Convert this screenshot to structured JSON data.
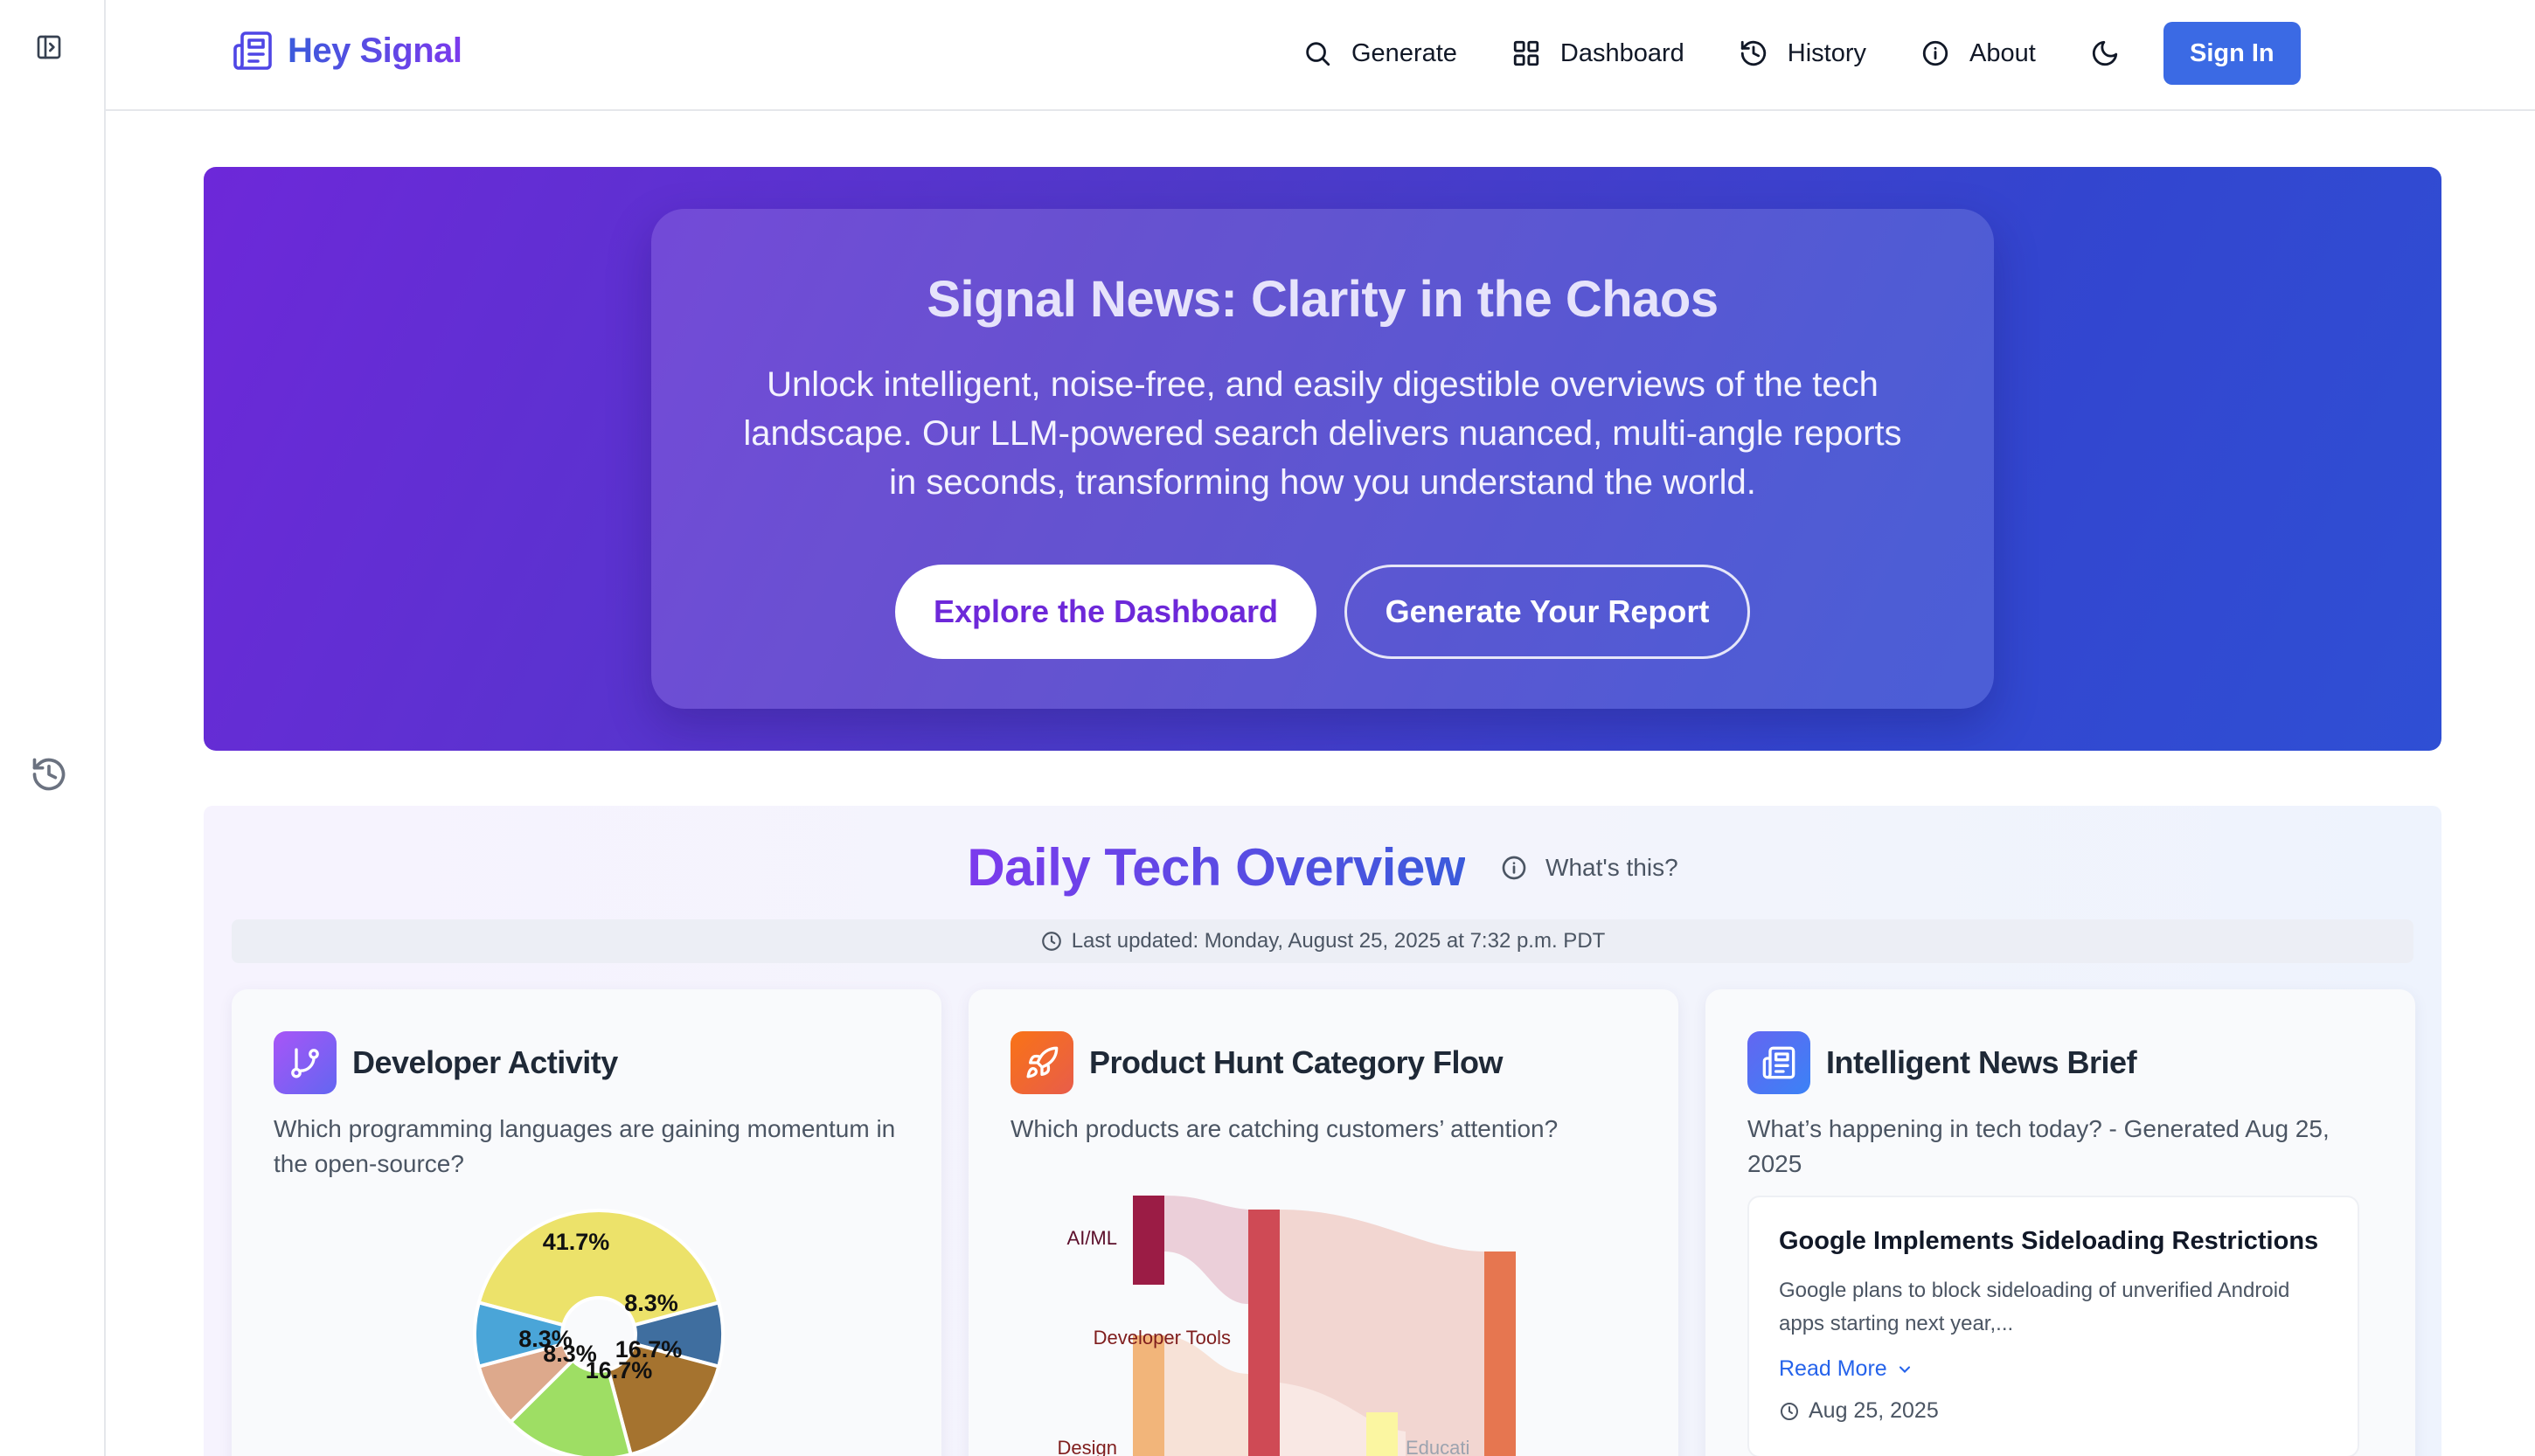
{
  "header": {
    "brand": "Hey Signal",
    "nav": [
      {
        "label": "Generate",
        "icon": "search-icon"
      },
      {
        "label": "Dashboard",
        "icon": "grid-icon"
      },
      {
        "label": "History",
        "icon": "history-icon"
      },
      {
        "label": "About",
        "icon": "info-icon"
      }
    ],
    "theme_toggle_icon": "moon-icon",
    "sign_in": "Sign In"
  },
  "hero": {
    "title": "Signal News: Clarity in the Chaos",
    "subtitle": "Unlock intelligent, noise-free, and easily digestible overviews of the tech landscape. Our LLM-powered search delivers nuanced, multi-angle reports in seconds, transforming how you understand the world.",
    "primary_button": "Explore the Dashboard",
    "secondary_button": "Generate Your Report"
  },
  "overview": {
    "title": "Daily Tech Overview",
    "whats_this": "What's this?",
    "last_updated": "Last updated: Monday, August 25, 2025 at 7:32 p.m. PDT",
    "cards": {
      "developer": {
        "title": "Developer Activity",
        "desc": "Which programming languages are gaining momentum in the open-source?"
      },
      "product": {
        "title": "Product Hunt Category Flow",
        "desc": "Which products are catching customers’ attention?"
      },
      "news": {
        "title": "Intelligent News Brief",
        "desc": "What’s happening in tech today? - Generated Aug 25, 2025",
        "item": {
          "title": "Google Implements Sideloading Restrictions",
          "body": "Google plans to block sideloading of unverified Android apps starting next year,...",
          "read_more": "Read More",
          "date": "Aug 25, 2025"
        }
      }
    }
  },
  "chart_data": [
    {
      "type": "pie",
      "slices": [
        {
          "label": "41.7%",
          "value": 41.7,
          "color": "#ece26a"
        },
        {
          "label": "8.3%",
          "value": 8.3,
          "color": "#3f6e9f"
        },
        {
          "label": "16.7%",
          "value": 16.7,
          "color": "#a5732f"
        },
        {
          "label": "16.7%",
          "value": 16.7,
          "color": "#9ede64"
        },
        {
          "label": "8.3%",
          "value": 8.3,
          "color": "#dda98c"
        },
        {
          "label": "8.3%",
          "value": 8.3,
          "color": "#4aa5d8"
        }
      ]
    },
    {
      "type": "sankey",
      "nodes": [
        "AI/ML",
        "Developer Tools",
        "Design",
        "Educati"
      ],
      "colors": {
        "ai_ml": "#9b1c45",
        "developer_tools": "#f2b57a",
        "middle": "#cf4a55",
        "right": "#e67650",
        "yellow": "#fbf6a1"
      }
    }
  ]
}
